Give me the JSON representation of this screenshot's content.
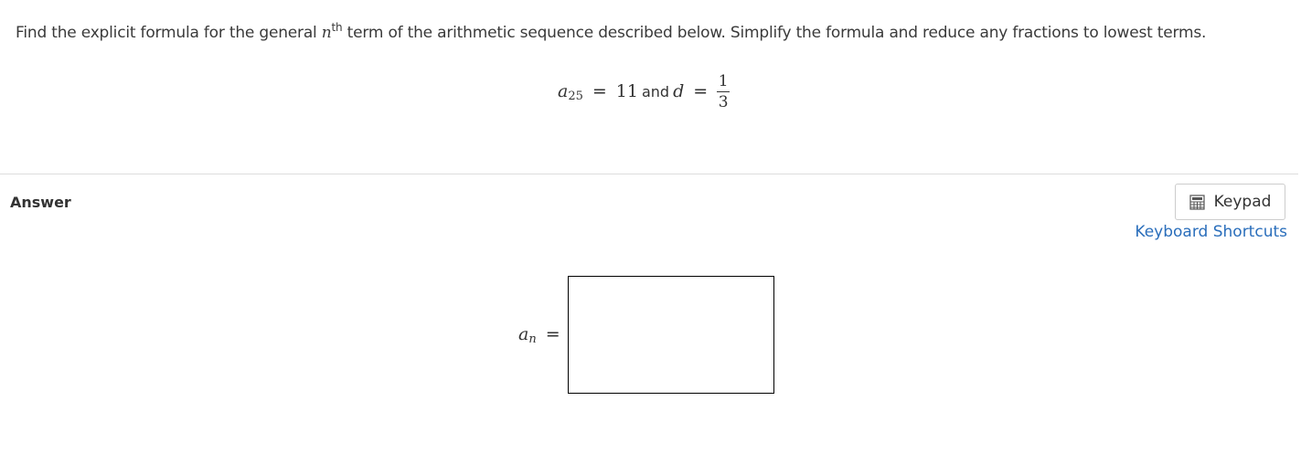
{
  "question": {
    "text_before": "Find the explicit formula for the general ",
    "n_var": "n",
    "superscript": "th",
    "text_after": " term of the arithmetic sequence described below. Simplify the formula and reduce any fractions to lowest terms."
  },
  "given": {
    "a_var": "a",
    "a_sub": "25",
    "eq1": "=",
    "a_value": "11",
    "and_text": "and",
    "d_var": "d",
    "eq2": "=",
    "d_numerator": "1",
    "d_denominator": "3"
  },
  "answer": {
    "label": "Answer",
    "keypad_label": "Keypad",
    "keypad_icon": "calculator-icon",
    "shortcuts_label": "Keyboard Shortcuts",
    "an_var": "a",
    "an_sub": "n",
    "an_eq": "=",
    "input_value": ""
  },
  "colors": {
    "link": "#2a6ebb",
    "text": "#333333",
    "divider": "#dcdcdc"
  }
}
